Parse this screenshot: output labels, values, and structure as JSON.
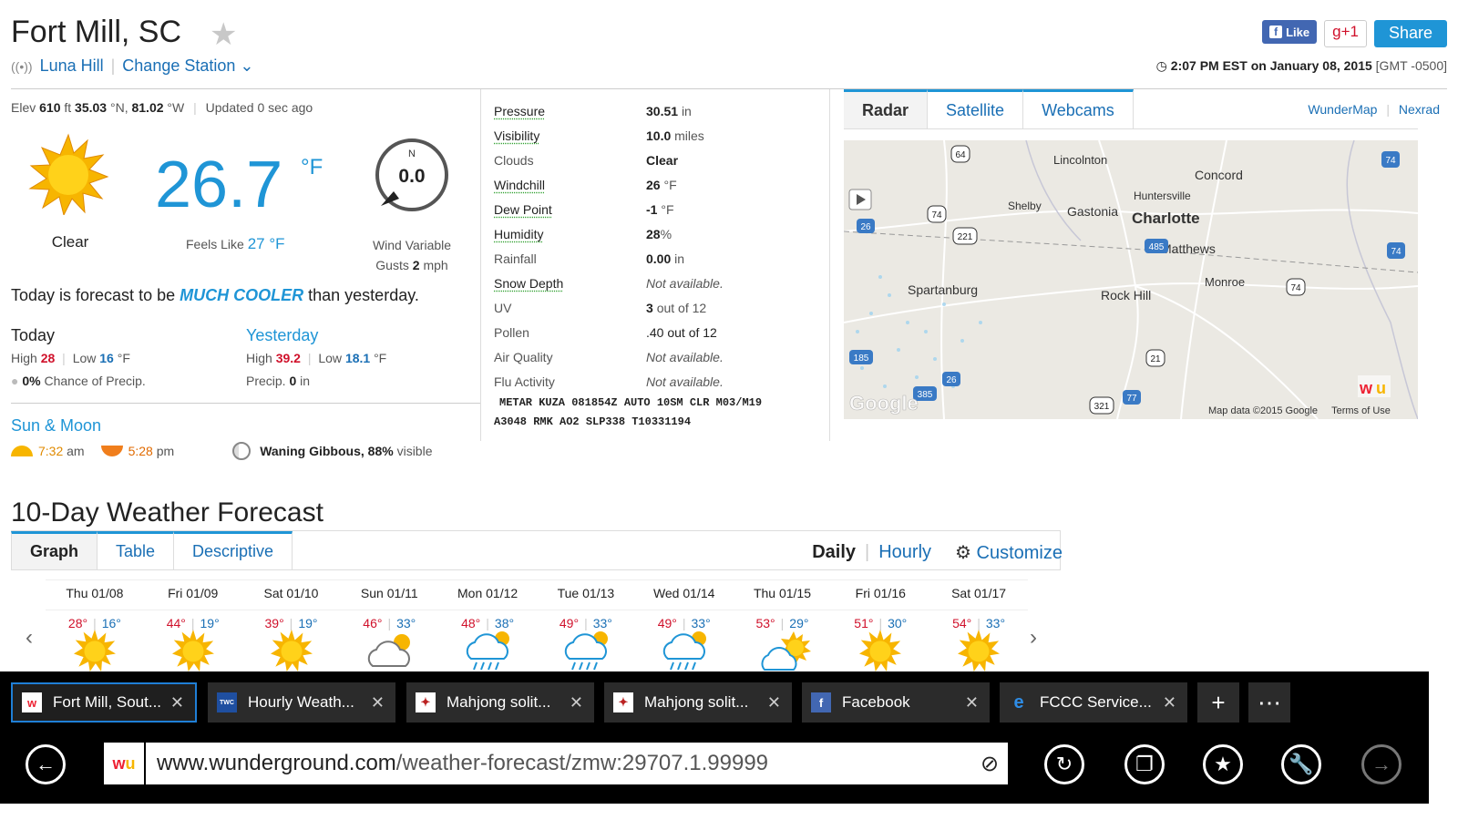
{
  "header": {
    "title": "Fort Mill, SC",
    "station_name": "Luna Hill",
    "change_station": "Change Station",
    "fb_like": "Like",
    "gplus": "g+1",
    "share": "Share",
    "time": "2:07 PM EST on January 08, 2015",
    "gmt": "[GMT -0500]"
  },
  "current": {
    "elev_label": "Elev",
    "elev": "610",
    "elev_unit": "ft",
    "lat": "35.03",
    "lat_dir": "°N,",
    "lon": "81.02",
    "lon_dir": "°W",
    "updated": "Updated 0 sec ago",
    "condition": "Clear",
    "temp": "26.7",
    "temp_unit": "°F",
    "feels_label": "Feels Like",
    "feels": "27 °F",
    "wind_dir": "N",
    "wind_speed": "0.0",
    "wind_label": "Wind Variable",
    "gusts_label": "Gusts",
    "gusts": "2",
    "gusts_unit": "mph",
    "forecast_pre": "Today is forecast to be",
    "forecast_emph": "MUCH COOLER",
    "forecast_post": "than yesterday."
  },
  "today": {
    "title": "Today",
    "high_label": "High",
    "high": "28",
    "low_label": "Low",
    "low": "16",
    "unit": "°F",
    "precip_pct": "0%",
    "precip_label": "Chance of Precip."
  },
  "yesterday": {
    "title": "Yesterday",
    "high_label": "High",
    "high": "39.2",
    "low_label": "Low",
    "low": "18.1",
    "unit": "°F",
    "precip_label": "Precip.",
    "precip": "0",
    "precip_unit": "in"
  },
  "sunmoon": {
    "title": "Sun & Moon",
    "sunrise": "7:32",
    "sunrise_ampm": "am",
    "sunset": "5:28",
    "sunset_ampm": "pm",
    "moon_phase": "Waning Gibbous,",
    "moon_pct": "88%",
    "moon_visible": "visible"
  },
  "conditions": [
    {
      "k": "Pressure",
      "v": "30.51",
      "u": "in",
      "link": true
    },
    {
      "k": "Visibility",
      "v": "10.0",
      "u": "miles",
      "link": true
    },
    {
      "k": "Clouds",
      "v": "Clear",
      "u": "",
      "link": false
    },
    {
      "k": "Windchill",
      "v": "26",
      "u": "°F",
      "link": true
    },
    {
      "k": "Dew Point",
      "v": "-1",
      "u": "°F",
      "link": true
    },
    {
      "k": "Humidity",
      "v": "28",
      "u": "%",
      "link": true
    },
    {
      "k": "Rainfall",
      "v": "0.00",
      "u": "in",
      "link": false
    },
    {
      "k": "Snow Depth",
      "v": "Not available.",
      "u": "",
      "link": true,
      "na": true
    },
    {
      "k": "UV",
      "v": "3",
      "u": "out of 12",
      "link": false
    },
    {
      "k": "Pollen",
      "v": ".40 out of 12",
      "u": "",
      "link": false,
      "blue": true
    },
    {
      "k": "Air Quality",
      "v": "Not available.",
      "u": "",
      "link": false,
      "na": true
    },
    {
      "k": "Flu Activity",
      "v": "Not available.",
      "u": "",
      "link": false,
      "na": true
    }
  ],
  "metar": {
    "line1": "METAR KUZA 081854Z AUTO 10SM CLR M03/M19",
    "line2": "A3048 RMK AO2 SLP338 T10331194"
  },
  "map": {
    "tabs": [
      "Radar",
      "Satellite",
      "Webcams"
    ],
    "link1": "WunderMap",
    "link2": "Nexrad",
    "credit": "Map data ©2015 Google",
    "terms": "Terms of Use",
    "cities": [
      "Lincolnton",
      "Concord",
      "Huntersville",
      "Shelby",
      "Gastonia",
      "Charlotte",
      "Matthews",
      "Monroe",
      "Spartanburg",
      "Rock Hill"
    ],
    "watermark": "Google"
  },
  "tenday": {
    "title": "10-Day Weather Forecast",
    "tabs": [
      "Graph",
      "Table",
      "Descriptive"
    ],
    "daily": "Daily",
    "hourly": "Hourly",
    "customize": "Customize",
    "days": [
      {
        "d": "Thu 01/08",
        "hi": "28°",
        "lo": "16°",
        "icon": "sun"
      },
      {
        "d": "Fri 01/09",
        "hi": "44°",
        "lo": "19°",
        "icon": "sun"
      },
      {
        "d": "Sat 01/10",
        "hi": "39°",
        "lo": "19°",
        "icon": "sun"
      },
      {
        "d": "Sun 01/11",
        "hi": "46°",
        "lo": "33°",
        "icon": "cloud"
      },
      {
        "d": "Mon 01/12",
        "hi": "48°",
        "lo": "38°",
        "icon": "rain"
      },
      {
        "d": "Tue 01/13",
        "hi": "49°",
        "lo": "33°",
        "icon": "rain"
      },
      {
        "d": "Wed 01/14",
        "hi": "49°",
        "lo": "33°",
        "icon": "rain"
      },
      {
        "d": "Thu 01/15",
        "hi": "53°",
        "lo": "29°",
        "icon": "partly"
      },
      {
        "d": "Fri 01/16",
        "hi": "51°",
        "lo": "30°",
        "icon": "sun"
      },
      {
        "d": "Sat 01/17",
        "hi": "54°",
        "lo": "33°",
        "icon": "sun"
      }
    ]
  },
  "browser": {
    "tabs": [
      {
        "label": "Fort Mill, Sout...",
        "active": true,
        "fav": "wu"
      },
      {
        "label": "Hourly Weath...",
        "active": false,
        "fav": "twc"
      },
      {
        "label": "Mahjong solit...",
        "active": false,
        "fav": "mj"
      },
      {
        "label": "Mahjong solit...",
        "active": false,
        "fav": "mj"
      },
      {
        "label": "Facebook",
        "active": false,
        "fav": "fb"
      },
      {
        "label": "FCCC Service...",
        "active": false,
        "fav": "ie"
      }
    ],
    "url_host": "www.wunderground.com",
    "url_path": "/weather-forecast/zmw:29707.1.99999"
  }
}
